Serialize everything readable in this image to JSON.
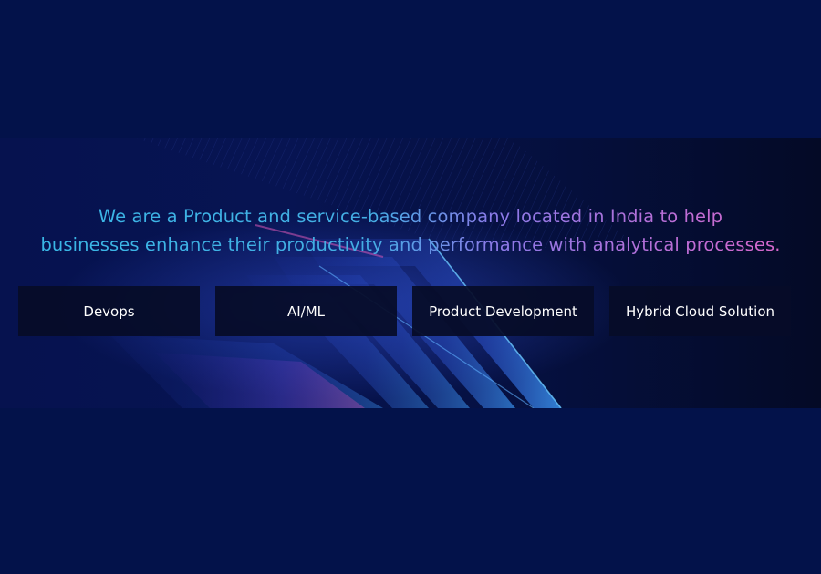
{
  "colors": {
    "page_background": "#03124a",
    "text_start": "#38b8e6",
    "text_end": "#e265c8",
    "card_background": "#060c28",
    "card_text": "#ffffff",
    "accent_glow": "#3f6bff"
  },
  "hero": {
    "line1": "We are a Product and service-based company located in India to help",
    "line2": "businesses enhance their productivity and performance with analytical processes."
  },
  "services": [
    {
      "label": "Devops"
    },
    {
      "label": "AI/ML"
    },
    {
      "label": "Product Development"
    },
    {
      "label": "Hybrid Cloud Solution"
    }
  ]
}
